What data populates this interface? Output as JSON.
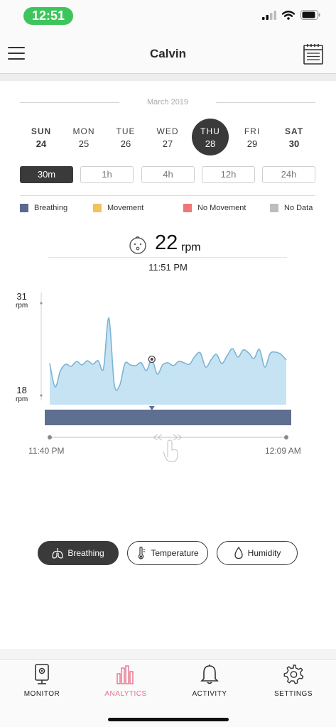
{
  "status": {
    "time": "12:51"
  },
  "nav": {
    "title": "Calvin"
  },
  "calendar": {
    "month": "March 2019",
    "days": [
      {
        "name": "SUN",
        "num": "24"
      },
      {
        "name": "MON",
        "num": "25"
      },
      {
        "name": "TUE",
        "num": "26"
      },
      {
        "name": "WED",
        "num": "27"
      },
      {
        "name": "THU",
        "num": "28"
      },
      {
        "name": "FRI",
        "num": "29"
      },
      {
        "name": "SAT",
        "num": "30"
      }
    ],
    "selected_index": 4
  },
  "ranges": [
    "30m",
    "1h",
    "4h",
    "12h",
    "24h"
  ],
  "active_range": "30m",
  "legend": [
    {
      "label": "Breathing",
      "color": "#5a6a8e"
    },
    {
      "label": "Movement",
      "color": "#f5c15a"
    },
    {
      "label": "No Movement",
      "color": "#ef7777"
    },
    {
      "label": "No Data",
      "color": "#bdbdbd"
    }
  ],
  "reading": {
    "value": "22",
    "unit": "rpm",
    "time": "11:51 PM"
  },
  "chart_data": {
    "type": "area",
    "ylim": [
      18,
      31
    ],
    "y_ticks": [
      {
        "value": "31",
        "unit": "rpm"
      },
      {
        "value": "18",
        "unit": "rpm"
      }
    ],
    "x_start": "11:40 PM",
    "x_end": "12:09 AM",
    "series": [
      {
        "values": [
          22.5,
          19.2,
          21.5,
          22.4,
          22.1,
          22.8,
          22.3,
          22.9,
          22.4,
          22.9,
          21.8,
          28.9,
          19.6,
          19.4,
          22.5,
          22.3,
          22.2,
          22.6,
          21.5,
          23.1,
          21.0,
          22.3,
          22.6,
          22.2,
          22.8,
          22.6,
          22.4,
          23.5,
          24.0,
          22.0,
          23.0,
          23.8,
          22.5,
          23.6,
          24.6,
          23.4,
          24.4,
          24.0,
          23.2,
          24.5,
          22.0,
          23.9,
          24.1,
          23.8,
          23.0
        ]
      }
    ],
    "timeline_color": "#5f6f92",
    "area_color": "#c6e3f3",
    "line_color": "#7bb4d4"
  },
  "metrics": [
    "Breathing",
    "Temperature",
    "Humidity"
  ],
  "active_metric": "Breathing",
  "tabs": [
    "MONITOR",
    "ANALYTICS",
    "ACTIVITY",
    "SETTINGS"
  ],
  "active_tab": "ANALYTICS"
}
